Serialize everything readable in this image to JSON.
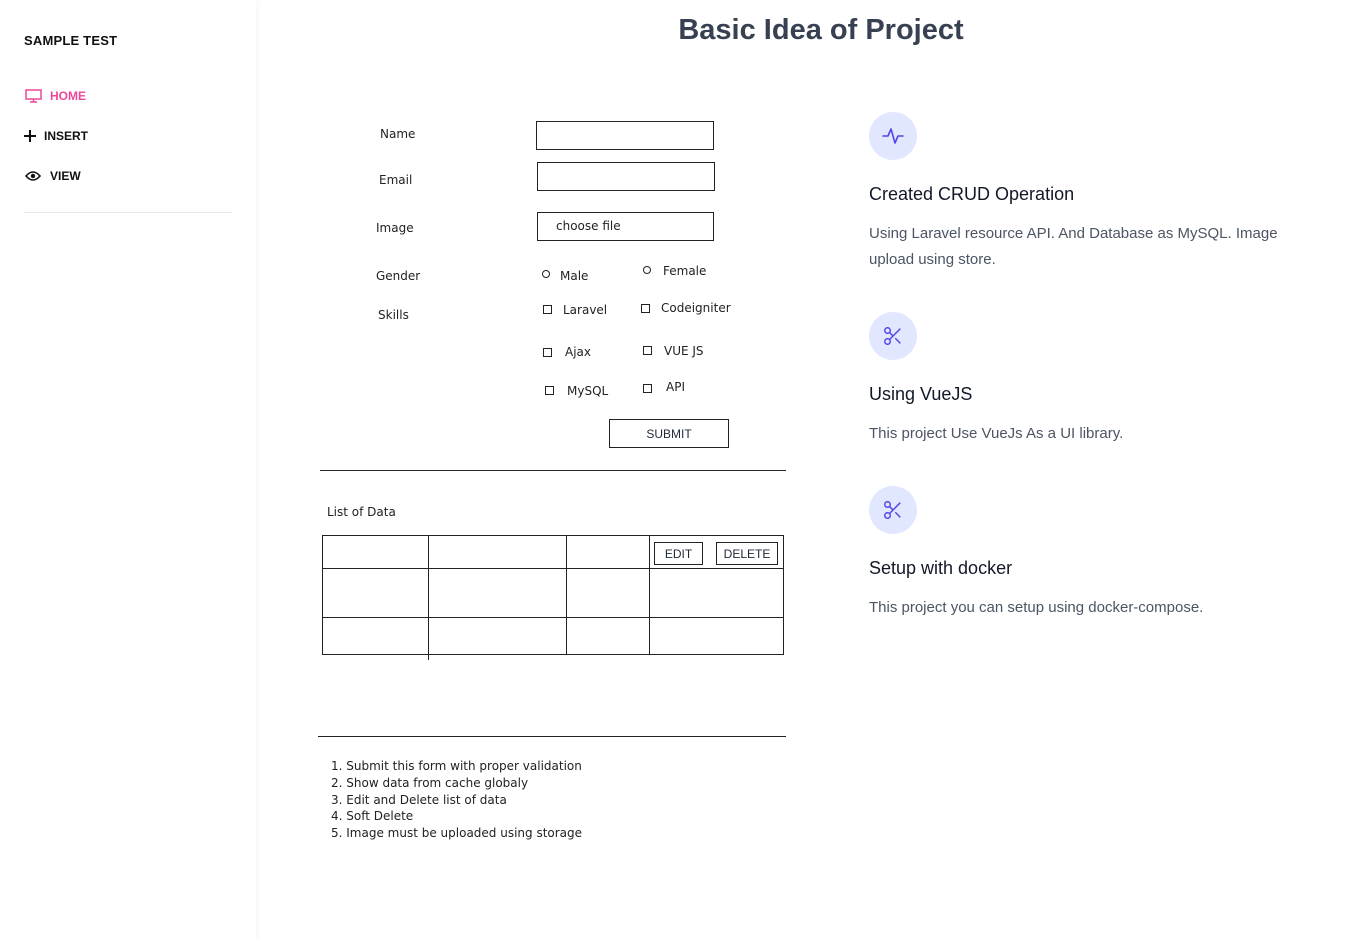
{
  "sidebar": {
    "brand": "SAMPLE TEST",
    "items": [
      {
        "label": "HOME",
        "icon": "monitor-icon",
        "active": true
      },
      {
        "label": "INSERT",
        "icon": "plus-icon",
        "active": false
      },
      {
        "label": "VIEW",
        "icon": "eye-icon",
        "active": false
      }
    ]
  },
  "page": {
    "title": "Basic Idea of Project"
  },
  "wireframe": {
    "form": {
      "name_label": "Name",
      "email_label": "Email",
      "image_label": "Image",
      "file_button": "choose file",
      "gender_label": "Gender",
      "gender_options": [
        "Male",
        "Female"
      ],
      "skills_label": "Skills",
      "skills": [
        "Laravel",
        "Codeigniter",
        "Ajax",
        "VUE JS",
        "MySQL",
        "API"
      ],
      "submit": "SUBMIT"
    },
    "list": {
      "title": "List of Data",
      "edit": "EDIT",
      "delete": "DELETE"
    },
    "notes": [
      "1. Submit this form with proper validation",
      "2. Show data from cache globaly",
      "3. Edit and Delete list of data",
      "4. Soft Delete",
      "5. Image must be uploaded using storage"
    ]
  },
  "features": [
    {
      "icon": "activity-icon",
      "title": "Created CRUD Operation",
      "desc": "Using Laravel resource API. And Database as MySQL. Image upload using store."
    },
    {
      "icon": "scissors-icon",
      "title": "Using VueJS",
      "desc": "This project Use VueJs As a UI library."
    },
    {
      "icon": "scissors-icon",
      "title": "Setup with docker",
      "desc": "This project you can setup using docker-compose."
    }
  ],
  "colors": {
    "accent": "#ec4899",
    "icon_bg": "#e0e7ff",
    "icon_fg": "#4f46e5"
  }
}
